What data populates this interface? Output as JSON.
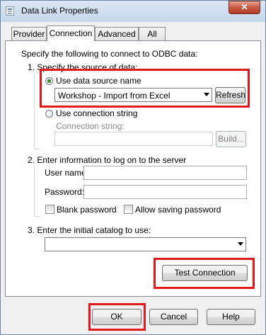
{
  "window": {
    "title": "Data Link Properties",
    "close_glyph": "✕"
  },
  "tabs": [
    {
      "label": "Provider"
    },
    {
      "label": "Connection"
    },
    {
      "label": "Advanced"
    },
    {
      "label": "All"
    }
  ],
  "connection": {
    "intro": "Specify the following to connect to ODBC data:",
    "step1": {
      "label": "1. Specify the source of data:",
      "use_dsn_label": "Use data source name",
      "dsn_value": "Workshop - Import from Excel",
      "refresh_label": "Refresh",
      "use_connstr_label": "Use connection string",
      "connstr_field_label": "Connection string:",
      "connstr_value": "",
      "build_label": "Build..."
    },
    "step2": {
      "label": "2. Enter information to log on to the server",
      "username_label": "User name:",
      "username_value": "",
      "password_label": "Password:",
      "password_value": "",
      "blank_password_label": "Blank password",
      "allow_saving_label": "Allow saving password"
    },
    "step3": {
      "label": "3. Enter the initial catalog to use:",
      "catalog_value": ""
    },
    "test_connection_label": "Test Connection"
  },
  "footer": {
    "ok_label": "OK",
    "cancel_label": "Cancel",
    "help_label": "Help"
  },
  "colors": {
    "highlight": "#e2181f",
    "close_button": "#c75a44"
  }
}
